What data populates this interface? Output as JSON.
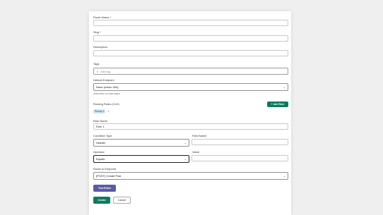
{
  "form": {
    "route_name_label": "Route Name *",
    "route_name_value": "",
    "slug_label": "Slug *",
    "slug_value": "",
    "description_label": "Description",
    "description_value": "",
    "tags_label": "Tags",
    "tags_placeholder": "Add tag",
    "default_endpoint_label": "Default Endpoint",
    "default_endpoint_value": "None (return 404)",
    "default_endpoint_hint": "Used when no rules match",
    "routing_rules_label": "Routing Rules (1/10)",
    "add_rule_label": "+ Add Rule",
    "rule_badge": "Priority 1",
    "rule_remove": "×",
    "rule_name_label": "Rule Name",
    "rule_name_value": "Rule 1",
    "condition_type_label": "Condition Type",
    "condition_type_value": "Header",
    "field_name_label": "Field Name",
    "field_name_value": "",
    "operator_label": "Operator",
    "operator_value": "Equals",
    "value_label": "Value",
    "value_value": "",
    "route_to_label": "Route to Endpoint",
    "route_to_value": "[POST] Create Post",
    "test_rules_label": "Test Rules",
    "create_label": "Create",
    "cancel_label": "Cancel"
  },
  "icons": {
    "tag": "tag-icon",
    "chevron": "chevron-down-icon"
  },
  "colors": {
    "primary": "#0e7a5f",
    "secondary": "#5a5aa6",
    "badge_bg": "#cfe6f5",
    "remove": "#c0392b"
  }
}
